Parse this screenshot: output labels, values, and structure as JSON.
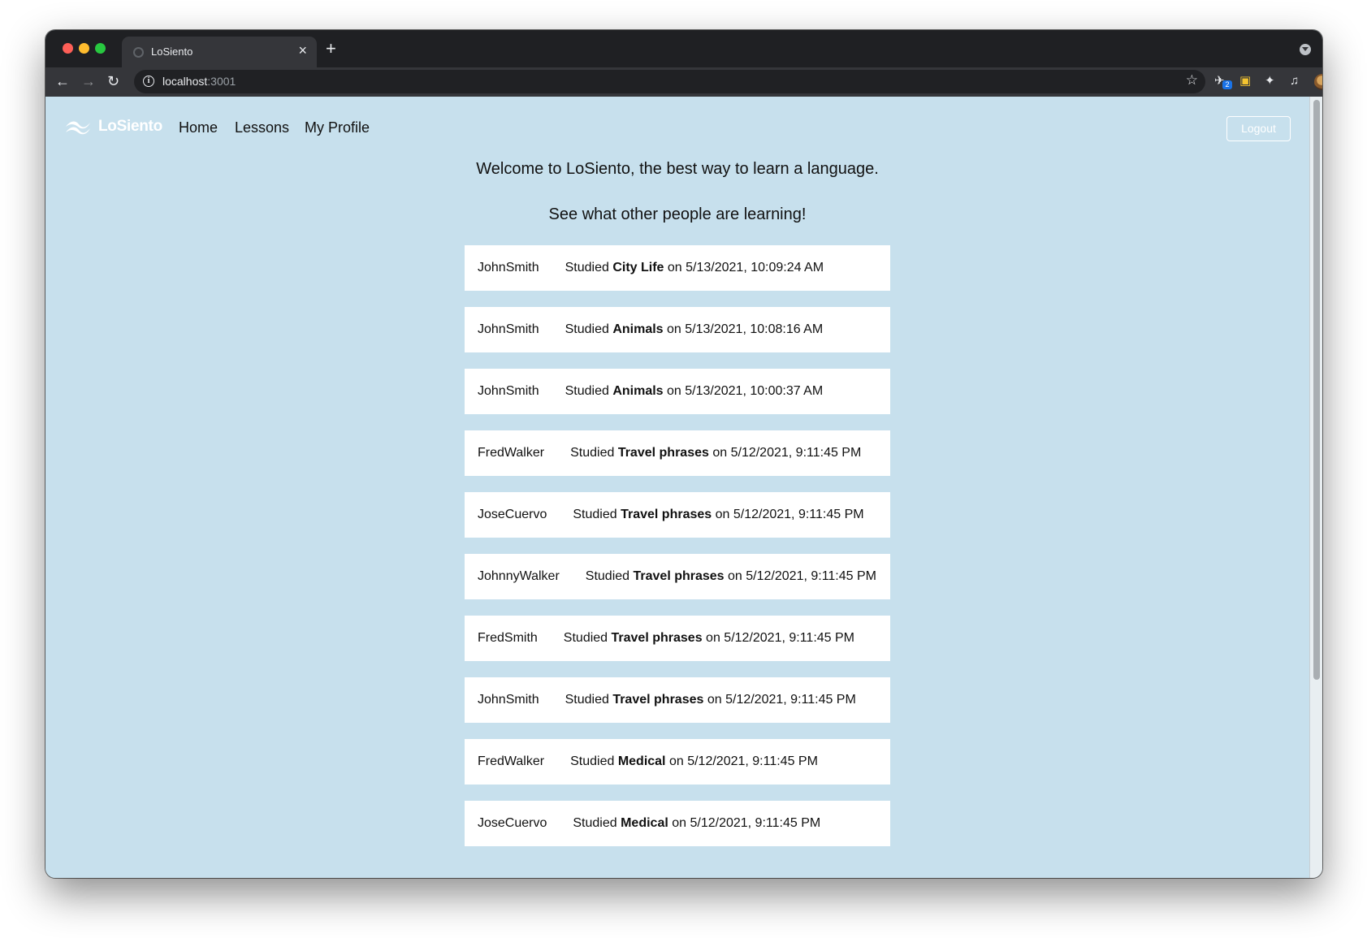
{
  "browser": {
    "tab_title": "LoSiento",
    "tab_close": "×",
    "new_tab": "+",
    "url_host": "localhost",
    "url_port": ":3001",
    "extension_badge": "2"
  },
  "navbar": {
    "brand": "LoSiento",
    "links": [
      "Home",
      "Lessons",
      "My Profile"
    ],
    "logout": "Logout"
  },
  "main": {
    "welcome": "Welcome to LoSiento, the best way to learn a language.",
    "subheading": "See what other people are learning!"
  },
  "feed": [
    {
      "user": "JohnSmith",
      "prefix": "Studied",
      "lesson": "City Life",
      "connector": "on",
      "timestamp": "5/13/2021, 10:09:24 AM"
    },
    {
      "user": "JohnSmith",
      "prefix": "Studied",
      "lesson": "Animals",
      "connector": "on",
      "timestamp": "5/13/2021, 10:08:16 AM"
    },
    {
      "user": "JohnSmith",
      "prefix": "Studied",
      "lesson": "Animals",
      "connector": "on",
      "timestamp": "5/13/2021, 10:00:37 AM"
    },
    {
      "user": "FredWalker",
      "prefix": "Studied",
      "lesson": "Travel phrases",
      "connector": "on",
      "timestamp": "5/12/2021, 9:11:45 PM"
    },
    {
      "user": "JoseCuervo",
      "prefix": "Studied",
      "lesson": "Travel phrases",
      "connector": "on",
      "timestamp": "5/12/2021, 9:11:45 PM"
    },
    {
      "user": "JohnnyWalker",
      "prefix": "Studied",
      "lesson": "Travel phrases",
      "connector": "on",
      "timestamp": "5/12/2021, 9:11:45 PM"
    },
    {
      "user": "FredSmith",
      "prefix": "Studied",
      "lesson": "Travel phrases",
      "connector": "on",
      "timestamp": "5/12/2021, 9:11:45 PM"
    },
    {
      "user": "JohnSmith",
      "prefix": "Studied",
      "lesson": "Travel phrases",
      "connector": "on",
      "timestamp": "5/12/2021, 9:11:45 PM"
    },
    {
      "user": "FredWalker",
      "prefix": "Studied",
      "lesson": "Medical",
      "connector": "on",
      "timestamp": "5/12/2021, 9:11:45 PM"
    },
    {
      "user": "JoseCuervo",
      "prefix": "Studied",
      "lesson": "Medical",
      "connector": "on",
      "timestamp": "5/12/2021, 9:11:45 PM"
    }
  ],
  "colors": {
    "page_background": "#c7e0ed",
    "card_background": "#ffffff",
    "chrome_dark": "#35363a"
  },
  "icons": [
    "globe-icon",
    "close-icon",
    "plus-icon",
    "back-icon",
    "forward-icon",
    "reload-icon",
    "info-icon",
    "star-icon",
    "extension-icon",
    "lock-icon",
    "puzzle-icon",
    "media-icon",
    "avatar",
    "menu-icon",
    "wave-logo-icon"
  ]
}
